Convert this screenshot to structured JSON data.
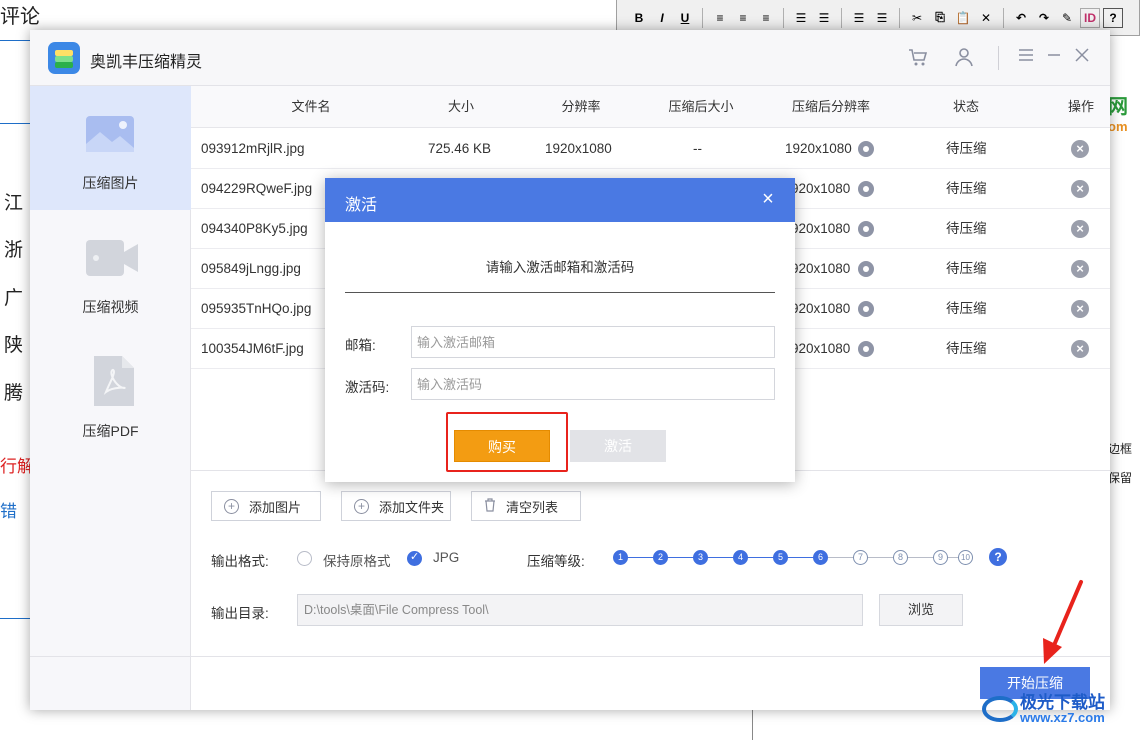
{
  "background": {
    "title": "评论",
    "side_chars": [
      "江",
      "浙",
      "广",
      "陕",
      "腾"
    ],
    "red_text": "行解",
    "blue_text": "错",
    "toolbar_buttons": [
      "B",
      "I",
      "U",
      "≡",
      "≡",
      "≡",
      "☰",
      "☰",
      "☰",
      "☰",
      "✂",
      "⎘",
      "📋",
      "✕",
      "↶",
      "↷",
      "✎",
      "ID",
      "?"
    ],
    "right_text_1": "网",
    "right_text_2": "om",
    "right_text_3": "边框",
    "right_text_4": "保留"
  },
  "app": {
    "title": "奥凯丰压缩精灵",
    "header_icons": [
      "cart-icon",
      "user-icon",
      "menu-icon",
      "minimize-icon",
      "close-icon"
    ],
    "sidebar": {
      "items": [
        {
          "label": "压缩图片",
          "icon": "image-icon",
          "active": true
        },
        {
          "label": "压缩视频",
          "icon": "video-icon",
          "active": false
        },
        {
          "label": "压缩PDF",
          "icon": "pdf-icon",
          "active": false
        }
      ]
    },
    "table": {
      "headers": [
        "文件名",
        "大小",
        "分辨率",
        "压缩后大小",
        "压缩后分辨率",
        "状态",
        "操作"
      ],
      "rows": [
        {
          "name": "093912mRjlR.jpg",
          "size": "725.46 KB",
          "resolution": "1920x1080",
          "compressed_size": "--",
          "compressed_resolution": "1920x1080",
          "status": "待压缩"
        },
        {
          "name": "094229RQweF.jpg",
          "size": "",
          "resolution": "",
          "compressed_size": "",
          "compressed_resolution": "920x1080",
          "status": "待压缩"
        },
        {
          "name": "094340P8Ky5.jpg",
          "size": "",
          "resolution": "",
          "compressed_size": "",
          "compressed_resolution": "920x1080",
          "status": "待压缩"
        },
        {
          "name": "095849jLngg.jpg",
          "size": "",
          "resolution": "",
          "compressed_size": "",
          "compressed_resolution": "920x1080",
          "status": "待压缩"
        },
        {
          "name": "095935TnHQo.jpg",
          "size": "",
          "resolution": "",
          "compressed_size": "",
          "compressed_resolution": "920x1080",
          "status": "待压缩"
        },
        {
          "name": "100354JM6tF.jpg",
          "size": "",
          "resolution": "",
          "compressed_size": "",
          "compressed_resolution": "920x1080",
          "status": "待压缩"
        }
      ]
    },
    "actions": {
      "add_image": "添加图片",
      "add_folder": "添加文件夹",
      "clear_list": "清空列表"
    },
    "output_format": {
      "label": "输出格式:",
      "options": [
        "保持原格式",
        "JPG"
      ],
      "selected": "JPG"
    },
    "compression_level": {
      "label": "压缩等级:",
      "levels": [
        "1",
        "2",
        "3",
        "4",
        "5",
        "6",
        "7",
        "8",
        "9",
        "10"
      ],
      "selected": 6,
      "help": "?"
    },
    "output_dir": {
      "label": "输出目录:",
      "value": "D:\\tools\\桌面\\File Compress Tool\\",
      "browse": "浏览"
    },
    "start_button": "开始压缩"
  },
  "modal": {
    "title": "激活",
    "close": "×",
    "prompt": "请输入激活邮箱和激活码",
    "email_label": "邮箱:",
    "email_placeholder": "输入激活邮箱",
    "code_label": "激活码:",
    "code_placeholder": "输入激活码",
    "buy_button": "购买",
    "activate_button": "激活"
  },
  "watermark": {
    "name": "极光下载站",
    "url": "www.xz7.com"
  },
  "colors": {
    "accent": "#4a79e3",
    "buy": "#f39c12",
    "highlight": "#e8231c"
  }
}
